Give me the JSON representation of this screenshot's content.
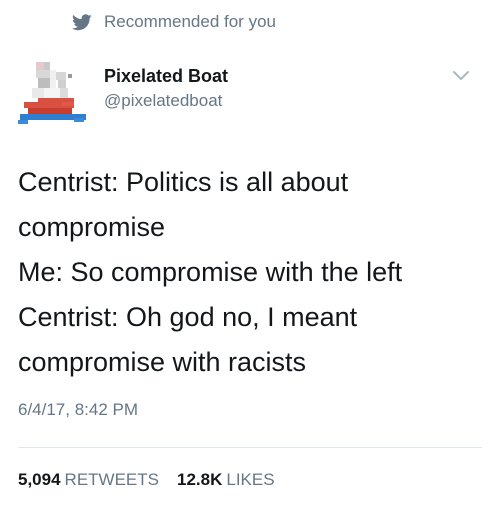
{
  "context": {
    "label": "Recommended for you",
    "icon": "twitter-bird-icon"
  },
  "author": {
    "display_name": "Pixelated Boat",
    "handle": "@pixelatedboat",
    "avatar_icon": "pixel-boat-avatar"
  },
  "tweet": {
    "lines": [
      "Centrist: Politics is all about",
      "compromise",
      "Me: So compromise with the left",
      "Centrist: Oh god no, I meant",
      "compromise with racists"
    ],
    "timestamp": "6/4/17, 8:42 PM"
  },
  "stats": {
    "retweets_count": "5,094",
    "retweets_label": "RETWEETS",
    "likes_count": "12.8K",
    "likes_label": "LIKES"
  },
  "colors": {
    "secondary_text": "#657786",
    "primary_text": "#14171a",
    "divider": "#e1e8ed"
  }
}
